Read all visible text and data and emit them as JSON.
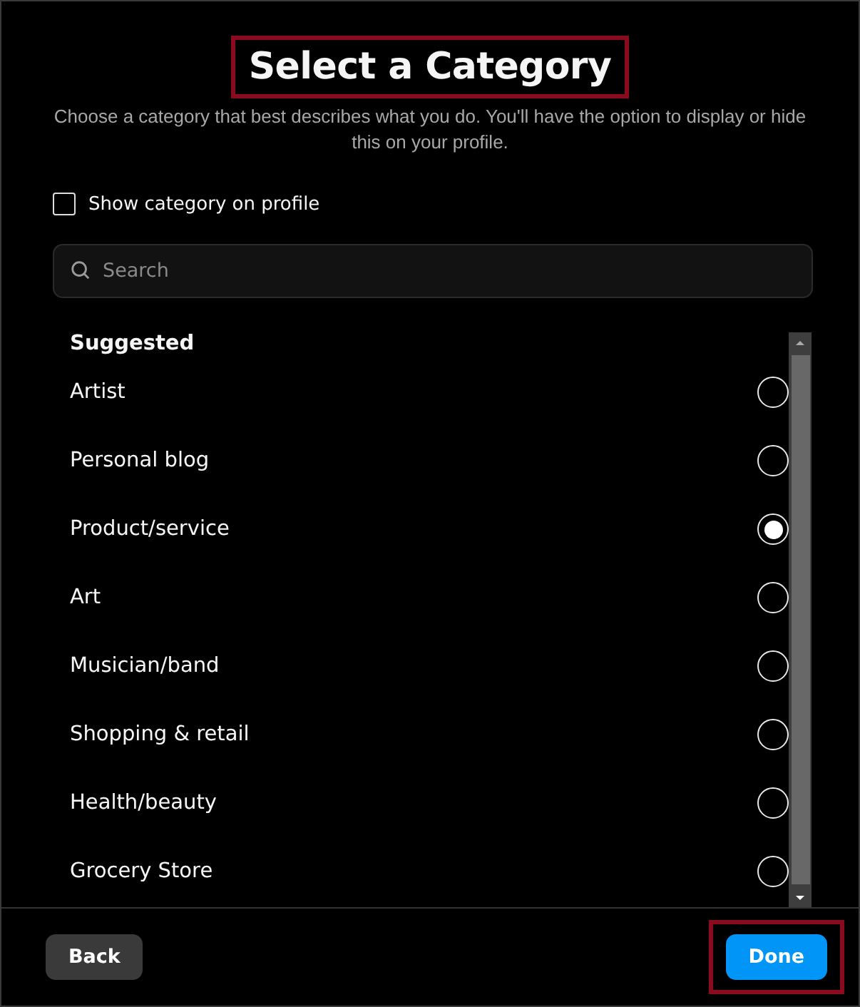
{
  "title": {
    "text": "Select a Category",
    "highlighted": true
  },
  "subtitle": "Choose a category that best describes what you do. You'll have the option to display or hide this on your profile.",
  "show_on_profile": {
    "label": "Show category on profile",
    "checked": false
  },
  "search": {
    "placeholder": "Search"
  },
  "section_heading": "Suggested",
  "categories": [
    {
      "label": "Artist",
      "selected": false
    },
    {
      "label": "Personal blog",
      "selected": false
    },
    {
      "label": "Product/service",
      "selected": true
    },
    {
      "label": "Art",
      "selected": false
    },
    {
      "label": "Musician/band",
      "selected": false
    },
    {
      "label": "Shopping & retail",
      "selected": false
    },
    {
      "label": "Health/beauty",
      "selected": false
    },
    {
      "label": "Grocery Store",
      "selected": false
    }
  ],
  "buttons": [
    {
      "label": "Back",
      "kind": "secondary",
      "highlighted": false
    },
    {
      "label": "Done",
      "kind": "primary",
      "highlighted": true
    }
  ]
}
